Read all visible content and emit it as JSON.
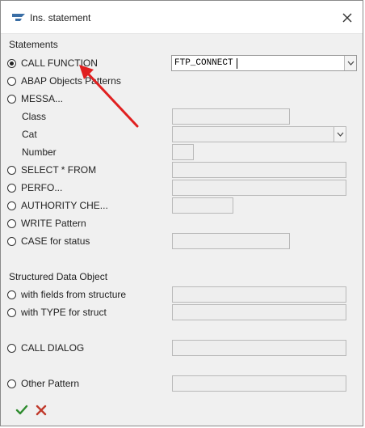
{
  "window": {
    "title": "Ins. statement",
    "close_icon": "close-icon",
    "app_icon": "sap-logo-icon"
  },
  "statements": {
    "heading": "Statements",
    "call_function": {
      "label": "CALL FUNCTION",
      "value": "FTP_CONNECT",
      "selected": true
    },
    "abap_objects": {
      "label": "ABAP Objects Patterns"
    },
    "messa": {
      "label": "MESSA..."
    },
    "message_fields": {
      "class_label": "Class",
      "cat_label": "Cat",
      "number_label": "Number"
    },
    "select_from": {
      "label": "SELECT * FROM"
    },
    "perform": {
      "label": "PERFO..."
    },
    "authority": {
      "label": "AUTHORITY CHE..."
    },
    "write_pattern": {
      "label": "WRITE Pattern"
    },
    "case_status": {
      "label": "CASE for status"
    }
  },
  "structured": {
    "heading": "Structured Data Object",
    "fields_from_structure": {
      "label": "with fields from structure"
    },
    "type_for_struct": {
      "label": "with TYPE for struct"
    }
  },
  "call_dialog": {
    "label": "CALL DIALOG"
  },
  "other_pattern": {
    "label": "Other Pattern"
  },
  "footer": {
    "confirm_icon": "check-icon",
    "cancel_icon": "cancel-x-icon",
    "confirm_color": "#2e8b2e",
    "cancel_color": "#c0392b"
  },
  "annotation": {
    "arrow_color": "#e02020"
  }
}
